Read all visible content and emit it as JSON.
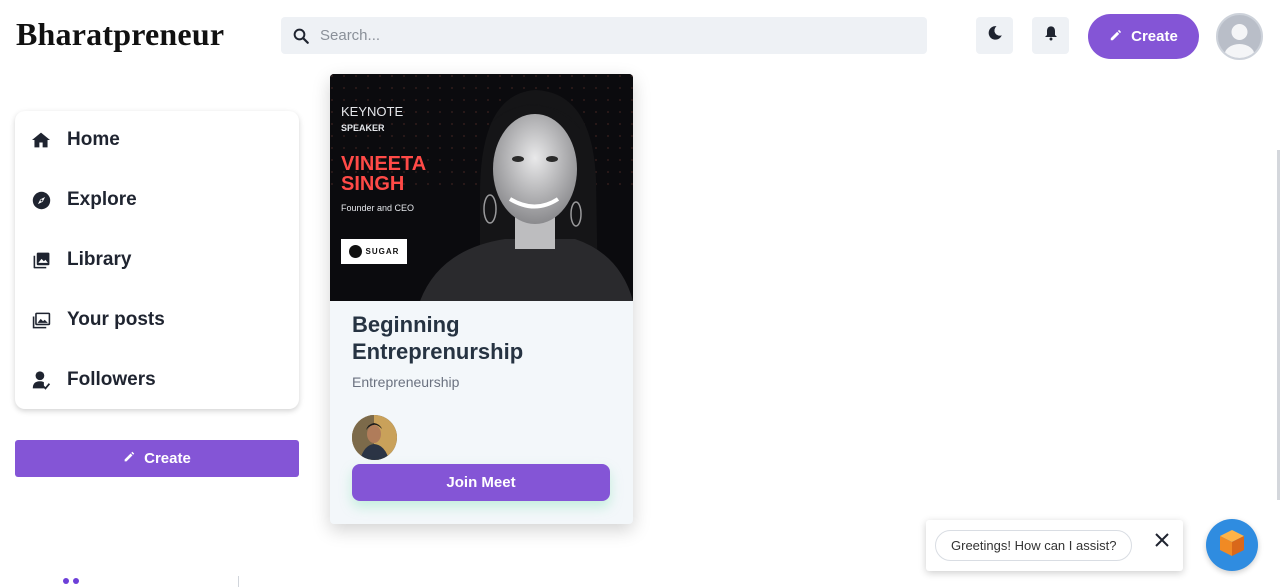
{
  "header": {
    "logo": "Bharatpreneur",
    "search_placeholder": "Search...",
    "create_label": "Create"
  },
  "sidebar": {
    "items": [
      {
        "label": "Home",
        "icon": "home-icon"
      },
      {
        "label": "Explore",
        "icon": "compass-icon"
      },
      {
        "label": "Library",
        "icon": "library-icon"
      },
      {
        "label": "Your posts",
        "icon": "images-icon"
      },
      {
        "label": "Followers",
        "icon": "user-check-icon"
      }
    ],
    "create_label": "Create"
  },
  "card": {
    "banner": {
      "keynote": "KEYNOTE",
      "speaker": "SPEAKER",
      "name_line1": "VINEETA",
      "name_line2": "SINGH",
      "role": "Founder and CEO",
      "brand": "SUGAR"
    },
    "title": "Beginning Entreprenurship",
    "category": "Entrepreneurship",
    "join_label": "Join Meet"
  },
  "chat": {
    "greeting": "Greetings! How can I assist?"
  },
  "colors": {
    "accent": "#8455d6",
    "banner_name": "#ff4a47",
    "chat_launcher": "#2f8ce0"
  }
}
